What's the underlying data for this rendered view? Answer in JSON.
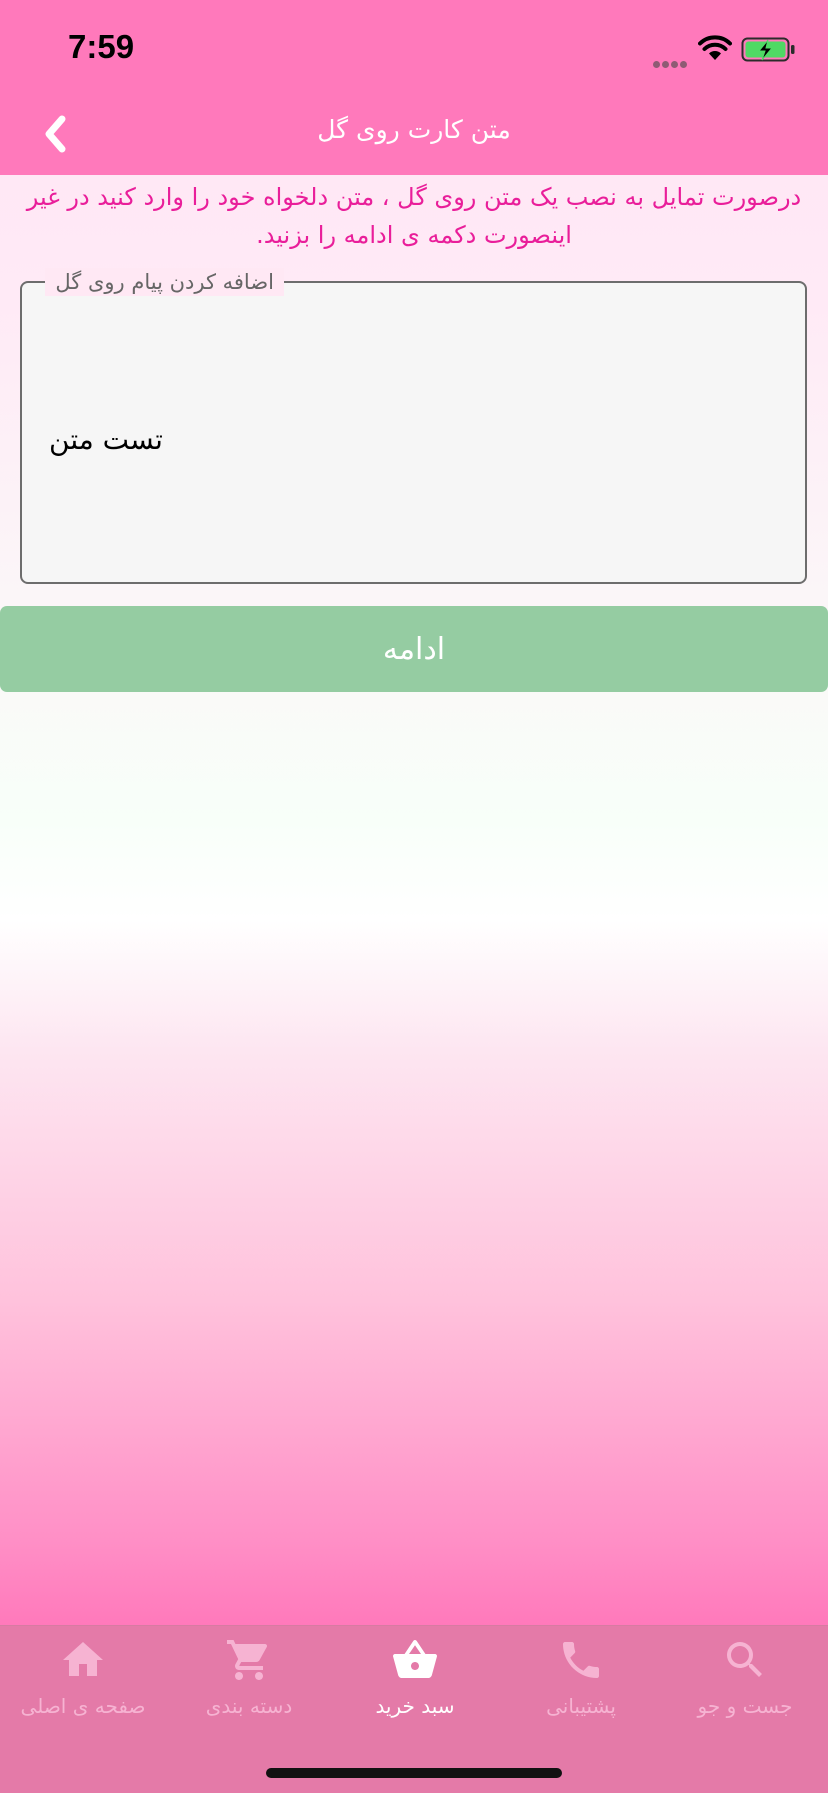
{
  "status_bar": {
    "time": "7:59",
    "icons": [
      "cellular-signal-icon",
      "wifi-icon",
      "battery-charging-icon"
    ]
  },
  "nav": {
    "title": "متن کارت روی گل",
    "back_icon": "chevron-left-icon"
  },
  "instructions": {
    "text": "درصورت تمایل به نصب یک متن روی گل ، متن دلخواه خود را وارد کنید در غیر اینصورت دکمه ی ادامه را بزنید."
  },
  "message_field": {
    "legend": "اضافه کردن پیام روی گل",
    "value": "تست متن"
  },
  "continue_button": {
    "label": "ادامه"
  },
  "tab_bar": {
    "tabs": [
      {
        "label": "صفحه ی اصلی",
        "icon": "home-icon",
        "active": false
      },
      {
        "label": "دسته بندی",
        "icon": "cart-icon",
        "active": false
      },
      {
        "label": "سبد خرید",
        "icon": "basket-icon",
        "active": true
      },
      {
        "label": "پشتیبانی",
        "icon": "phone-icon",
        "active": false
      },
      {
        "label": "جست و جو",
        "icon": "search-icon",
        "active": false
      }
    ]
  },
  "colors": {
    "header": "#ff79bb",
    "instruction_text": "#e91e9a",
    "continue_button": "#95cca2",
    "tab_bar": "#e47aa8",
    "tab_inactive": "#f6b3d2",
    "tab_active": "#ffffff"
  }
}
